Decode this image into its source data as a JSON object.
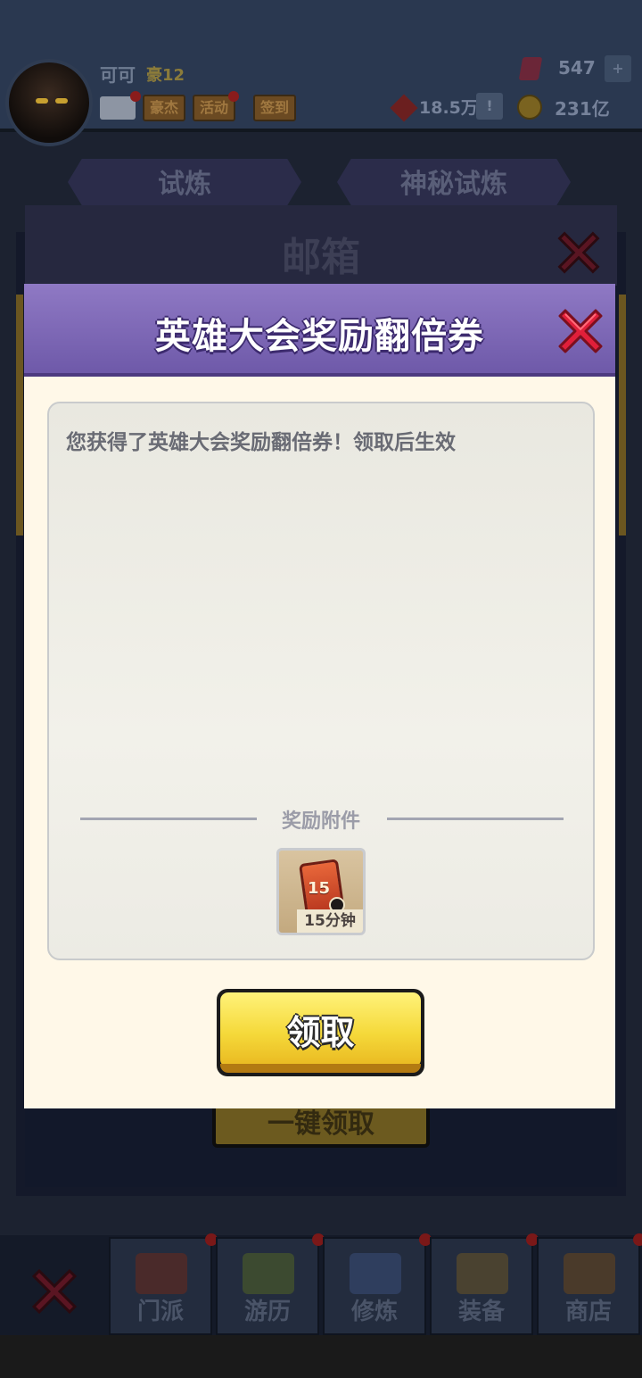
{
  "player": {
    "name": "可可",
    "vip": "豪12"
  },
  "header_buttons": [
    "豪杰",
    "活动",
    "签到"
  ],
  "resources": {
    "power": "18.5万",
    "power_warn": "!",
    "gems": "547",
    "gems_add": "+",
    "coins": "231亿"
  },
  "trial_tabs": [
    "试炼",
    "神秘试炼"
  ],
  "mailbox": {
    "title": "邮箱",
    "behind_button": "一键领取"
  },
  "dialog": {
    "title": "英雄大会奖励翻倍券",
    "message": "您获得了英雄大会奖励翻倍券！领取后生效",
    "attachment_label": "奖励附件",
    "reward": {
      "badge": "15",
      "caption": "15分钟"
    },
    "claim_label": "领取"
  },
  "bottom_nav": [
    {
      "label": "门派",
      "icon": "sect-gate-icon"
    },
    {
      "label": "游历",
      "icon": "travel-landscape-icon"
    },
    {
      "label": "修炼",
      "icon": "cultivation-book-icon"
    },
    {
      "label": "装备",
      "icon": "equipment-sword-icon"
    },
    {
      "label": "商店",
      "icon": "shop-house-icon"
    }
  ],
  "colors": {
    "dialog_header": "#7c67b8",
    "dialog_bg": "#fff8e8",
    "claim_button": "#f5d93a",
    "close_red": "#e01f3a"
  }
}
